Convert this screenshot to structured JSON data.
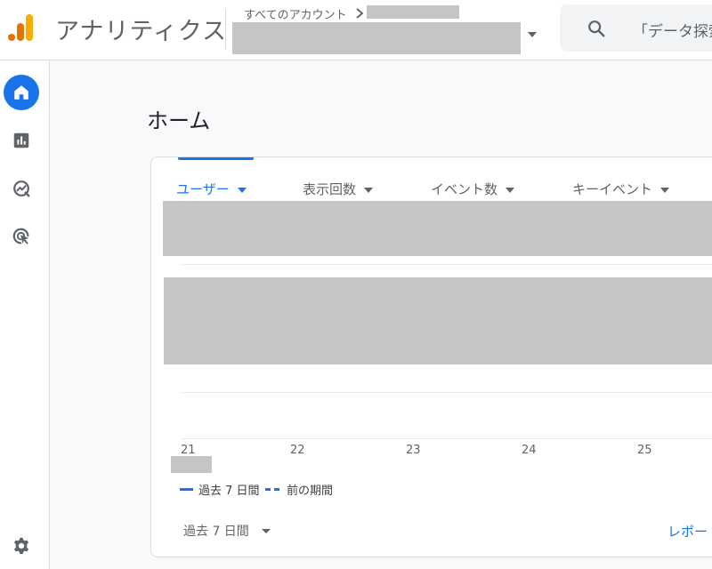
{
  "header": {
    "app_title": "アナリティクス",
    "account_crumb": "すべてのアカウント",
    "search_placeholder": "「データ探索"
  },
  "page": {
    "title": "ホーム"
  },
  "card": {
    "tabs": [
      {
        "label": "ユーザー",
        "active": true
      },
      {
        "label": "表示回数",
        "active": false
      },
      {
        "label": "イベント数",
        "active": false
      },
      {
        "label": "キーイベント",
        "active": false
      }
    ],
    "x_ticks": [
      "21",
      "22",
      "23",
      "24",
      "25"
    ],
    "legend": {
      "current": "過去 7 日間",
      "previous": "前の期間"
    },
    "date_range": "過去 7 日間",
    "report_link": "レポー"
  },
  "colors": {
    "accent": "#1a73e8",
    "logo_orange": "#f9ab00",
    "logo_dark_orange": "#e37400",
    "redaction": "#c5c5c5"
  },
  "icons": {
    "logo": "analytics-logo",
    "search": "search-icon",
    "nav": [
      "home-icon",
      "reports-icon",
      "explore-icon",
      "advertising-icon",
      "settings-icon"
    ]
  }
}
